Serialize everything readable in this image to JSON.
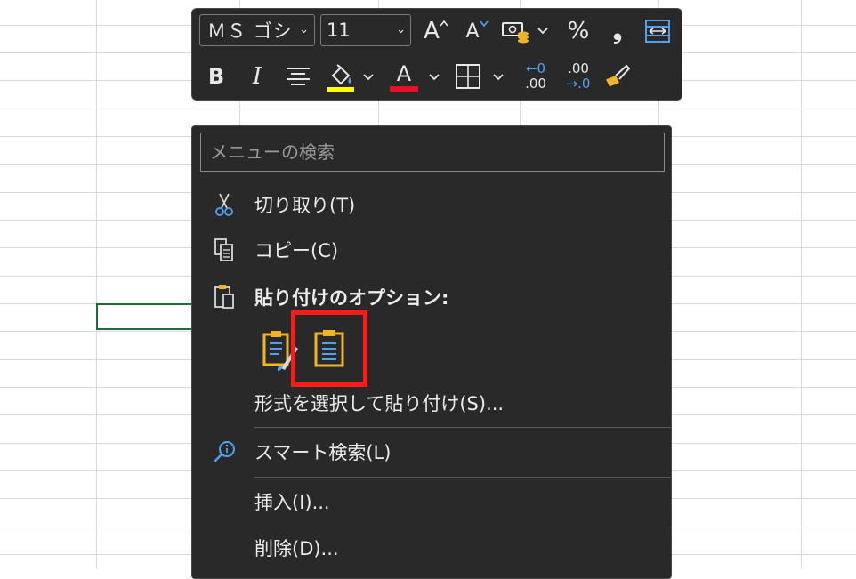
{
  "toolbar": {
    "font_name": "ＭＳ ゴシ",
    "font_size": "11",
    "grow_font": "A",
    "shrink_font": "A",
    "percent": "%",
    "comma": "❟",
    "bold": "B",
    "italic": "I",
    "font_color_letter": "A",
    "increase_decimal_top": "←0",
    "increase_decimal_bottom": ".00",
    "decrease_decimal_top": ".00",
    "decrease_decimal_bottom": "→.0",
    "colors": {
      "highlight": "#ffff00",
      "font_color": "#e81123",
      "accent": "#4ea3f1"
    }
  },
  "menu": {
    "search_placeholder": "メニューの検索",
    "cut": "切り取り(T)",
    "copy": "コピー(C)",
    "paste_options": "貼り付けのオプション:",
    "paste_special": "形式を選択して貼り付け(S)...",
    "smart_lookup": "スマート検索(L)",
    "insert": "挿入(I)...",
    "delete": "削除(D)..."
  }
}
